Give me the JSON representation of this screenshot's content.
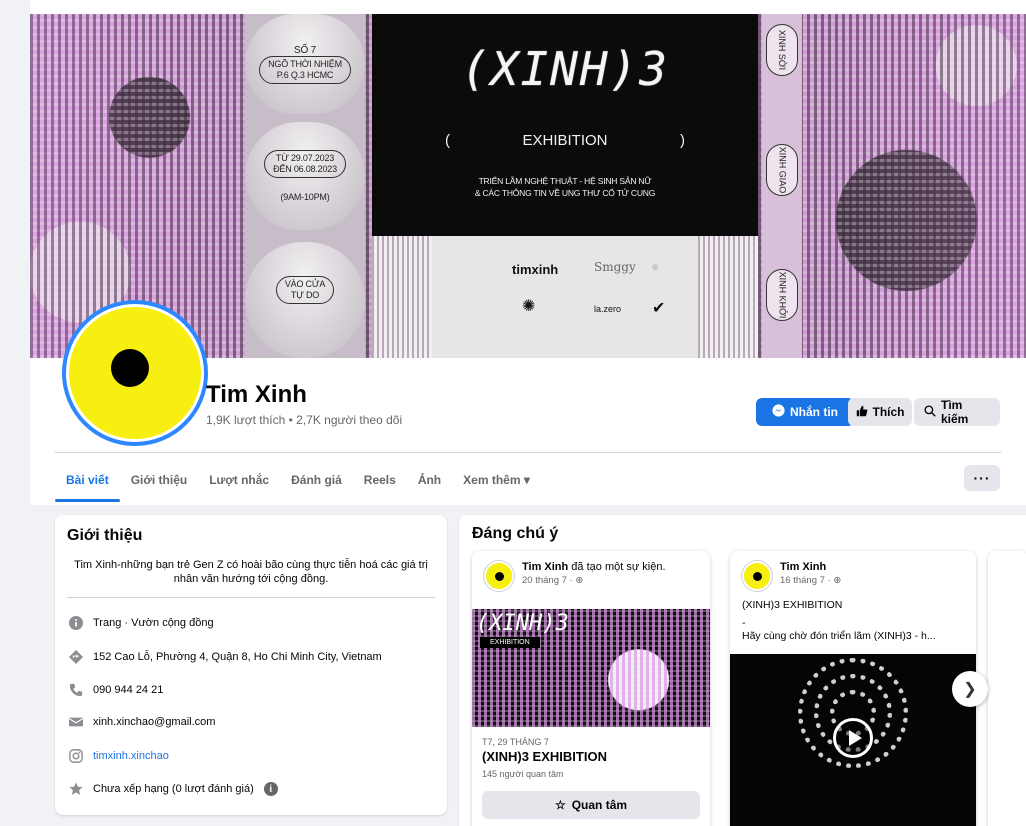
{
  "cover": {
    "pill1": [
      "SỐ 7",
      "NGÕ THỜI NHIỆM",
      "P.6 Q.3 HCMC"
    ],
    "pill2": [
      "TỪ 29.07.2023",
      "ĐẾN 06.08.2023",
      "(9AM-10PM)"
    ],
    "pill3": [
      "VÀO CỬA",
      "TỰ DO"
    ],
    "title": "(XINH)3",
    "exhibition": "EXHIBITION",
    "paren_open": "(",
    "paren_close": ")",
    "desc_line1": "TRIỂN LÃM NGHỆ THUẬT  -  HỆ SINH SẢN NỮ",
    "desc_line2": "& CÁC THÔNG TIN VỀ UNG THƯ CỔ TỬ CUNG",
    "sponsors": [
      "timxinh",
      "Smggy",
      "la.zero"
    ],
    "vtags": [
      "XINH SỜI",
      "XINH GIAO",
      "XINH KHỞI"
    ]
  },
  "page": {
    "name": "Tim Xinh",
    "stats": "1,9K lượt thích • 2,7K người theo dõi"
  },
  "actions": {
    "message": "Nhắn tin",
    "like": "Thích",
    "search": "Tìm kiếm"
  },
  "tabs": [
    "Bài viết",
    "Giới thiệu",
    "Lượt nhắc",
    "Đánh giá",
    "Reels",
    "Ảnh",
    "Xem thêm"
  ],
  "intro": {
    "title": "Giới thiệu",
    "bio": "Tim Xinh-những bạn trẻ Gen Z có hoài bão cùng thực tiễn hoá các giá trị nhân văn hướng tới cộng đồng.",
    "category": "Trang · Vườn cộng đồng",
    "address": "152 Cao Lỗ, Phường 4, Quận 8, Ho Chi Minh City, Vietnam",
    "phone": "090 944 24 21",
    "email": "xinh.xinchao@gmail.com",
    "instagram": "timxinh.xinchao",
    "rating": "Chưa xếp hạng (0 lượt đánh giá)"
  },
  "featured": {
    "title": "Đáng chú ý",
    "card1": {
      "author": "Tim Xinh",
      "action": " đã tạo một sự kiện.",
      "time": "20 tháng 7 · ",
      "img_title": "(XINH)3",
      "img_exh": "EXHIBITION",
      "date": "T7, 29 THÁNG 7",
      "event": "(XINH)3 EXHIBITION",
      "interested_count": "145 người quan tâm",
      "btn": "Quan tâm"
    },
    "card2": {
      "author": "Tim Xinh",
      "time": "16 tháng 7 · ",
      "line1": "(XINH)3 EXHIBITION",
      "line2": "-",
      "line3": "Hãy cùng chờ đón triển lãm (XINH)3 - h..."
    }
  },
  "colors": {
    "accent": "#1b74e4",
    "avatar_yellow": "#f7ef0f"
  }
}
